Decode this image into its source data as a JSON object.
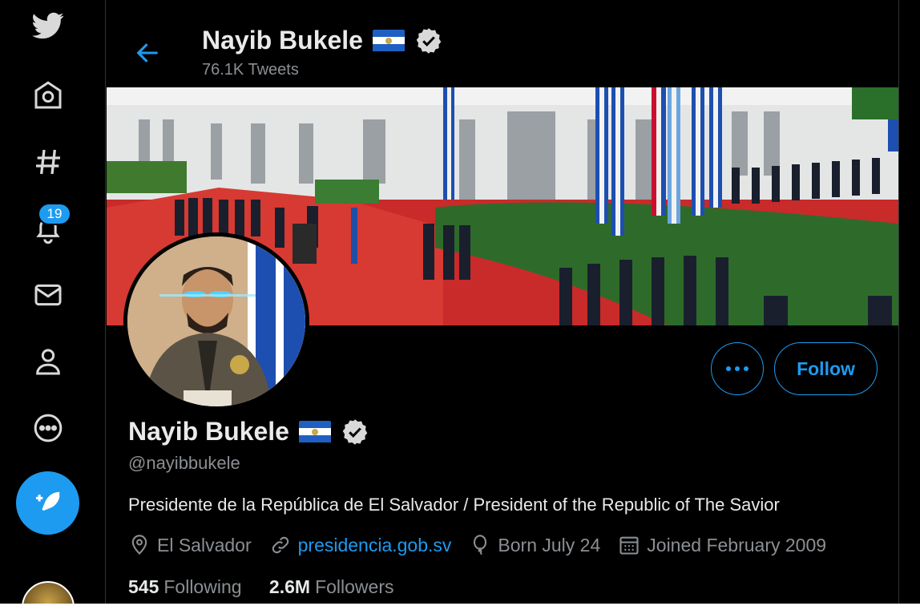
{
  "app": {
    "logo": "twitter-bird-icon"
  },
  "nav": {
    "items": [
      {
        "name": "home",
        "icon": "home-icon"
      },
      {
        "name": "explore",
        "icon": "hashtag-icon"
      },
      {
        "name": "notifications",
        "icon": "bell-icon"
      },
      {
        "name": "messages",
        "icon": "mail-icon"
      },
      {
        "name": "profile",
        "icon": "person-icon"
      },
      {
        "name": "more",
        "icon": "more-circle-icon"
      }
    ],
    "notification_count": "19",
    "compose_icon": "compose-feather-icon"
  },
  "header": {
    "name": "Nayib Bukele",
    "tweet_count": "76.1K Tweets"
  },
  "profile": {
    "name": "Nayib Bukele",
    "handle": "@nayibbukele",
    "bio": "Presidente de la República de El Salvador / President of the Republic of The Savior",
    "location": "El Salvador",
    "website": "presidencia.gob.sv",
    "birthday": "Born July 24",
    "joined": "Joined February 2009",
    "following_count": "545",
    "following_label": "Following",
    "followers_count": "2.6M",
    "followers_label": "Followers",
    "follow_label": "Follow"
  },
  "colors": {
    "accent": "#1d9bf0",
    "background": "#000000",
    "muted_text": "#8b8f93",
    "border": "#2f3336"
  }
}
